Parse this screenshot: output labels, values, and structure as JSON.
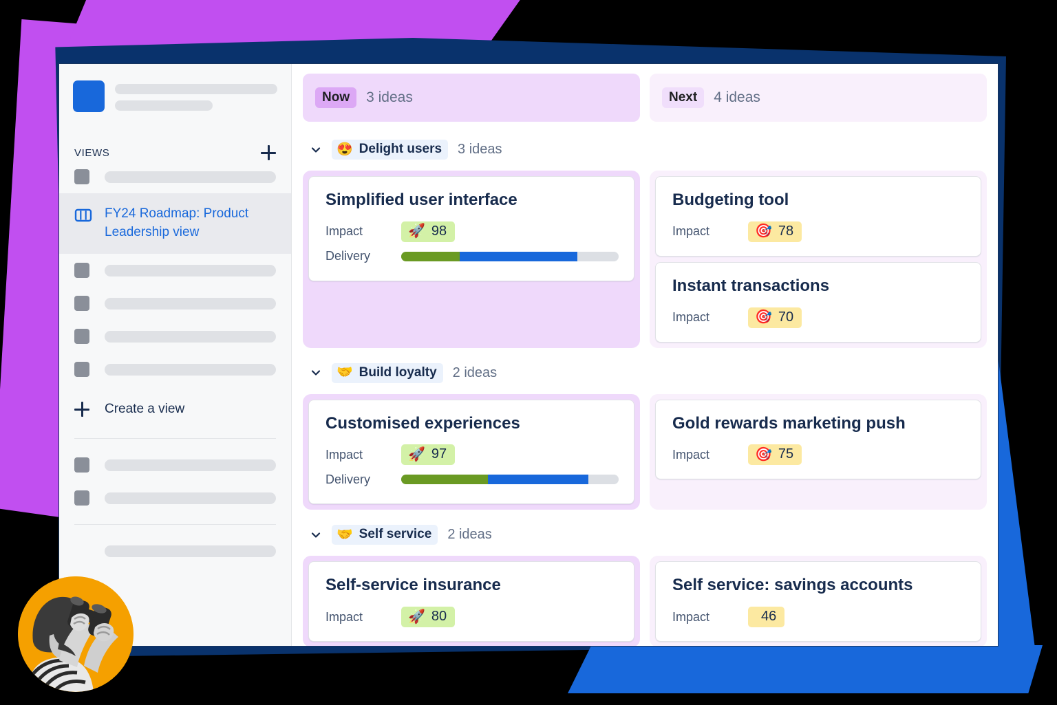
{
  "sidebar": {
    "section_title": "VIEWS",
    "add_view_icon": "plus-icon",
    "active_view": {
      "icon": "board-columns-icon",
      "label": "FY24 Roadmap: Product Leadership view"
    },
    "create_view": {
      "icon": "plus-icon",
      "label": "Create a view"
    },
    "placeholder_rows_top": 1,
    "placeholder_rows_mid": 4,
    "placeholder_rows_bottom": 2,
    "placeholder_rows_footer": 1
  },
  "board": {
    "columns": [
      {
        "id": "now",
        "badge": "Now",
        "count": "3 ideas",
        "header_bg": "#EFD9FB",
        "badge_bg": "#DCA8F5"
      },
      {
        "id": "next",
        "badge": "Next",
        "count": "4 ideas",
        "header_bg": "#F9F0FC",
        "badge_bg": "#F0DEFB"
      }
    ],
    "groups": [
      {
        "emoji": "😍",
        "emoji_name": "smiling-face-with-hearts-icon",
        "name": "Delight users",
        "count": "3 ideas",
        "now_cards": [
          {
            "title": "Simplified user interface",
            "impact_label": "Impact",
            "impact_value": "98",
            "impact_emoji": "🚀",
            "impact_emoji_name": "rocket-icon",
            "impact_color": "green",
            "delivery_label": "Delivery",
            "delivery_green_pct": 27,
            "delivery_blue_pct": 54
          }
        ],
        "next_cards": [
          {
            "title": "Budgeting tool",
            "impact_label": "Impact",
            "impact_value": "78",
            "impact_emoji": "🎯",
            "impact_emoji_name": "bullseye-icon",
            "impact_color": "yellow"
          },
          {
            "title": "Instant transactions",
            "impact_label": "Impact",
            "impact_value": "70",
            "impact_emoji": "🎯",
            "impact_emoji_name": "bullseye-icon",
            "impact_color": "yellow"
          }
        ]
      },
      {
        "emoji": "🤝",
        "emoji_name": "handshake-icon",
        "name": "Build loyalty",
        "count": "2 ideas",
        "now_cards": [
          {
            "title": "Customised experiences",
            "impact_label": "Impact",
            "impact_value": "97",
            "impact_emoji": "🚀",
            "impact_emoji_name": "rocket-icon",
            "impact_color": "green",
            "delivery_label": "Delivery",
            "delivery_green_pct": 40,
            "delivery_blue_pct": 46
          }
        ],
        "next_cards": [
          {
            "title": "Gold rewards marketing push",
            "impact_label": "Impact",
            "impact_value": "75",
            "impact_emoji": "🎯",
            "impact_emoji_name": "bullseye-icon",
            "impact_color": "yellow"
          }
        ]
      },
      {
        "emoji": "🤝",
        "emoji_name": "handshake-icon",
        "name": "Self service",
        "count": "2 ideas",
        "now_cards": [
          {
            "title": "Self-service insurance",
            "impact_label": "Impact",
            "impact_value": "80",
            "impact_emoji": "🚀",
            "impact_emoji_name": "rocket-icon",
            "impact_color": "green"
          }
        ],
        "next_cards": [
          {
            "title": "Self service: savings accounts",
            "impact_label": "Impact",
            "impact_value": "46",
            "impact_emoji": "",
            "impact_emoji_name": "none",
            "impact_color": "yellow"
          }
        ]
      }
    ]
  },
  "avatar": {
    "name": "person-with-binoculars-avatar",
    "bg": "#F5A000"
  },
  "decor": {
    "purple": "#C14FF0",
    "navy": "#09326C",
    "blue": "#1868DB"
  }
}
